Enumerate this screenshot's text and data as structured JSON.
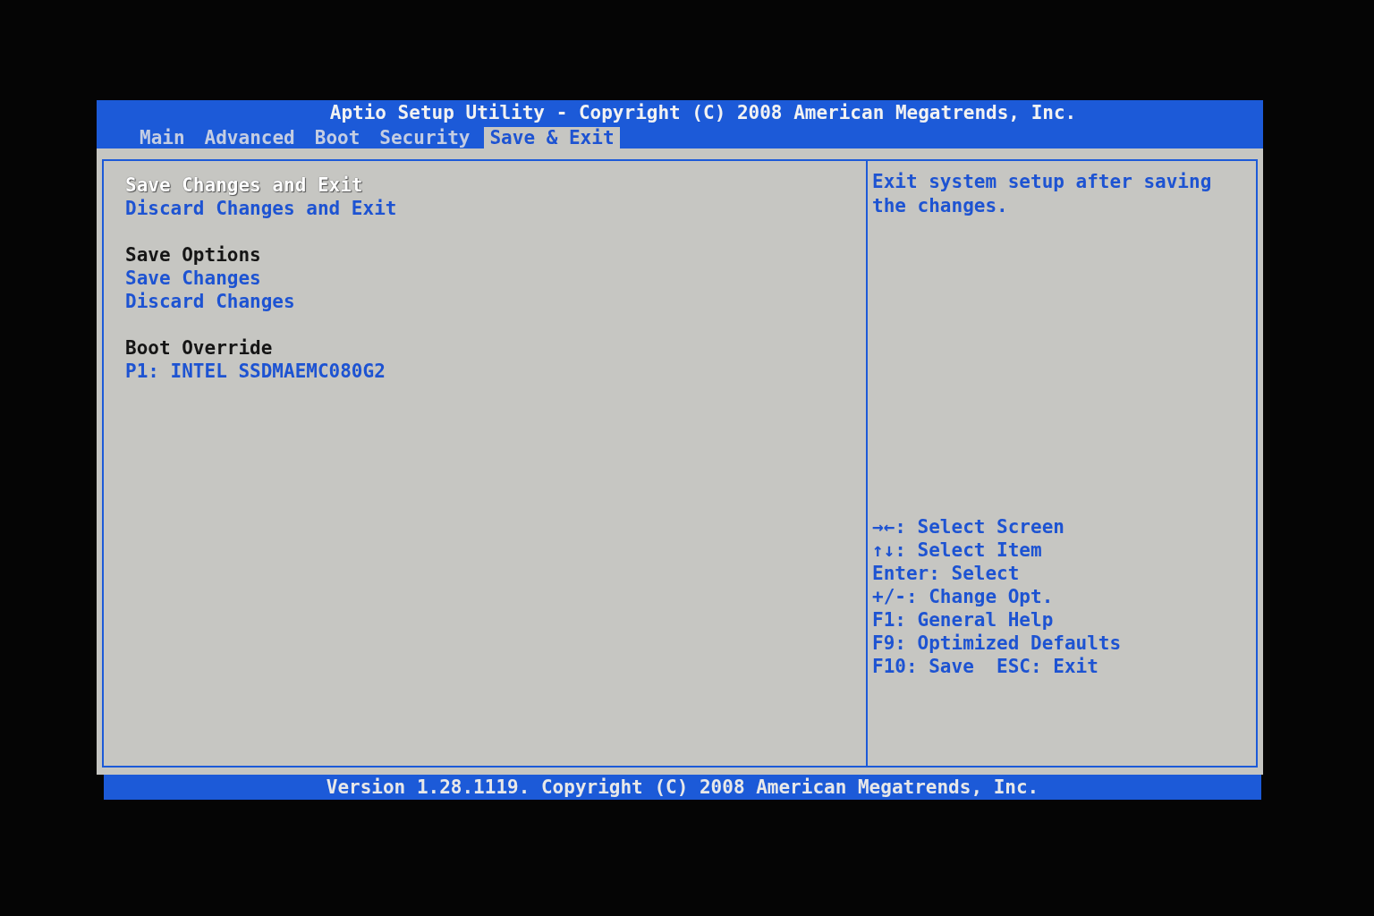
{
  "title": "Aptio Setup Utility - Copyright (C) 2008 American Megatrends, Inc.",
  "tabs": [
    {
      "label": "Main",
      "selected": false
    },
    {
      "label": "Advanced",
      "selected": false
    },
    {
      "label": "Boot",
      "selected": false
    },
    {
      "label": "Security",
      "selected": false
    },
    {
      "label": "Save & Exit",
      "selected": true
    }
  ],
  "menu_groups": [
    {
      "items": [
        {
          "kind": "action",
          "label": "Save Changes and Exit",
          "selected": true
        },
        {
          "kind": "action",
          "label": "Discard Changes and Exit",
          "selected": false
        }
      ]
    },
    {
      "items": [
        {
          "kind": "heading",
          "label": "Save Options"
        },
        {
          "kind": "action",
          "label": "Save Changes",
          "selected": false
        },
        {
          "kind": "action",
          "label": "Discard Changes",
          "selected": false
        }
      ]
    },
    {
      "items": [
        {
          "kind": "heading",
          "label": "Boot Override"
        },
        {
          "kind": "action",
          "label": "P1: INTEL SSDMAEMC080G2",
          "selected": false
        }
      ]
    }
  ],
  "help_text": "Exit system setup after saving the changes.",
  "key_legend": [
    "→←: Select Screen",
    "↑↓: Select Item",
    "Enter: Select",
    "+/-: Change Opt.",
    "F1: General Help",
    "F9: Optimized Defaults",
    "F10: Save  ESC: Exit"
  ],
  "footer": "Version 1.28.1119. Copyright (C) 2008 American Megatrends, Inc."
}
